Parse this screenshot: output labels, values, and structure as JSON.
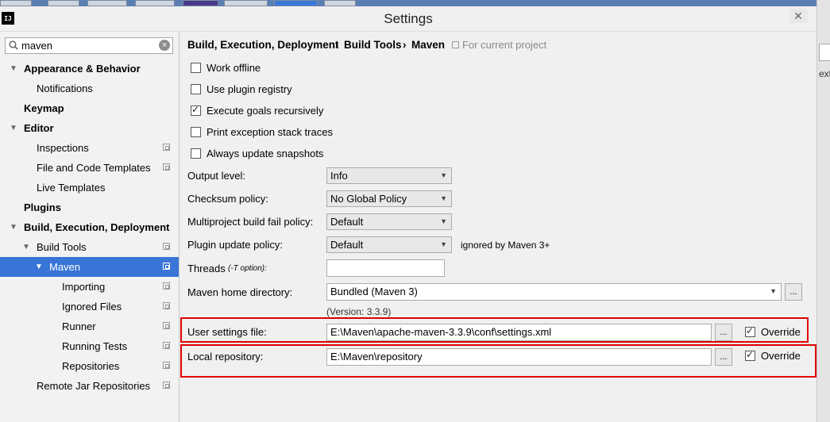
{
  "window": {
    "title": "Settings",
    "app_icon_text": "IJ",
    "close_glyph": "✕"
  },
  "background_app": {
    "fragment_text": "ext"
  },
  "search": {
    "value": "maven"
  },
  "sidebar": {
    "items": [
      {
        "label": "Appearance & Behavior"
      },
      {
        "label": "Notifications"
      },
      {
        "label": "Keymap"
      },
      {
        "label": "Editor"
      },
      {
        "label": "Inspections"
      },
      {
        "label": "File and Code Templates"
      },
      {
        "label": "Live Templates"
      },
      {
        "label": "Plugins"
      },
      {
        "label": "Build, Execution, Deployment"
      },
      {
        "label": "Build Tools"
      },
      {
        "label": "Maven"
      },
      {
        "label": "Importing"
      },
      {
        "label": "Ignored Files"
      },
      {
        "label": "Runner"
      },
      {
        "label": "Running Tests"
      },
      {
        "label": "Repositories"
      },
      {
        "label": "Remote Jar Repositories"
      }
    ]
  },
  "breadcrumb": {
    "part1": "Build, Execution, Deployment",
    "part2": "Build Tools",
    "part3": "Maven",
    "separator": "›",
    "scope_note": "For current project"
  },
  "options": [
    {
      "label": "Work offline",
      "checked": false
    },
    {
      "label": "Use plugin registry",
      "checked": false
    },
    {
      "label": "Execute goals recursively",
      "checked": true
    },
    {
      "label": "Print exception stack traces",
      "checked": false
    },
    {
      "label": "Always update snapshots",
      "checked": false
    }
  ],
  "fields": {
    "output_level": {
      "label": "Output level:",
      "value": "Info"
    },
    "checksum_policy": {
      "label": "Checksum policy:",
      "value": "No Global Policy"
    },
    "multiproject_fail_policy": {
      "label": "Multiproject build fail policy:",
      "value": "Default"
    },
    "plugin_update_policy": {
      "label": "Plugin update policy:",
      "value": "Default",
      "note": "ignored by Maven 3+"
    },
    "threads": {
      "label": "Threads",
      "hint": "(-T option):",
      "value": ""
    },
    "maven_home": {
      "label": "Maven home directory:",
      "value": "Bundled (Maven 3)",
      "version": "(Version: 3.3.9)"
    },
    "user_settings": {
      "label": "User settings file:",
      "value": "E:\\Maven\\apache-maven-3.3.9\\conf\\settings.xml",
      "override_label": "Override",
      "override_checked": true
    },
    "local_repository": {
      "label": "Local repository:",
      "value": "E:\\Maven\\repository",
      "override_label": "Override",
      "override_checked": true
    }
  },
  "browse_label": "...",
  "colors": {
    "selection": "#3875d7",
    "highlight_box": "#e00000",
    "taskbar": "#5b7fb0"
  }
}
